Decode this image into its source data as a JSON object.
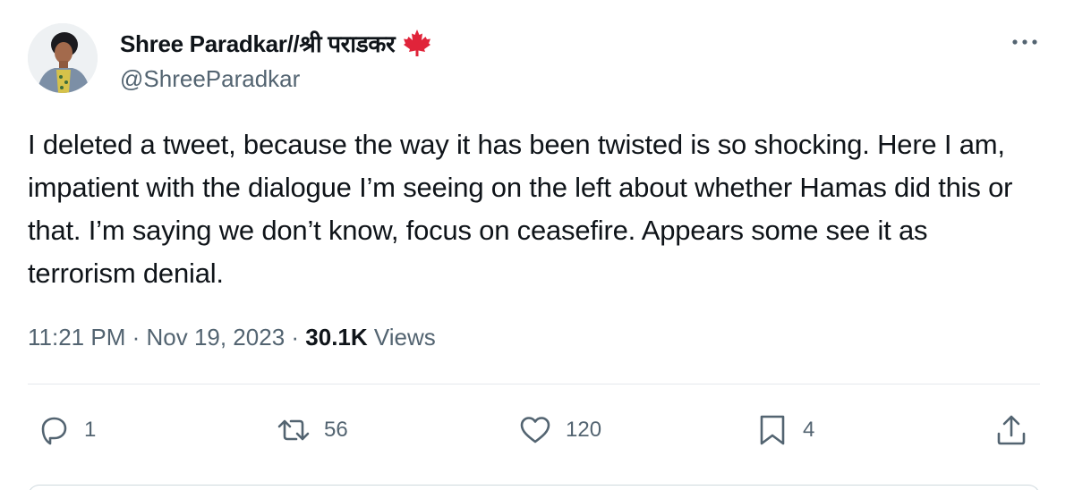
{
  "author": {
    "display_name": "Shree Paradkar//श्री पराडकर",
    "handle": "@ShreeParadkar",
    "flag_icon": "maple-leaf-icon",
    "flag_color": "#e0243a"
  },
  "tweet": {
    "text": "I deleted a tweet, because the way it has been twisted is so shocking. Here I am, impatient with the dialogue I’m seeing on the left about whether Hamas did this or that. I’m saying we don’t know, focus on ceasefire. Appears some see it as terrorism denial.",
    "time": "11:21 PM",
    "date": "Nov 19, 2023",
    "separator": "·",
    "views_count": "30.1K",
    "views_label": "Views"
  },
  "actions": {
    "reply_count": "1",
    "retweet_count": "56",
    "like_count": "120",
    "bookmark_count": "4"
  },
  "icons": {
    "reply": "reply-icon",
    "retweet": "retweet-icon",
    "like": "heart-icon",
    "bookmark": "bookmark-icon",
    "share": "share-icon",
    "more": "more-icon"
  },
  "colors": {
    "text_primary": "#0f1419",
    "text_secondary": "#536471",
    "divider": "#e5e9ec"
  }
}
